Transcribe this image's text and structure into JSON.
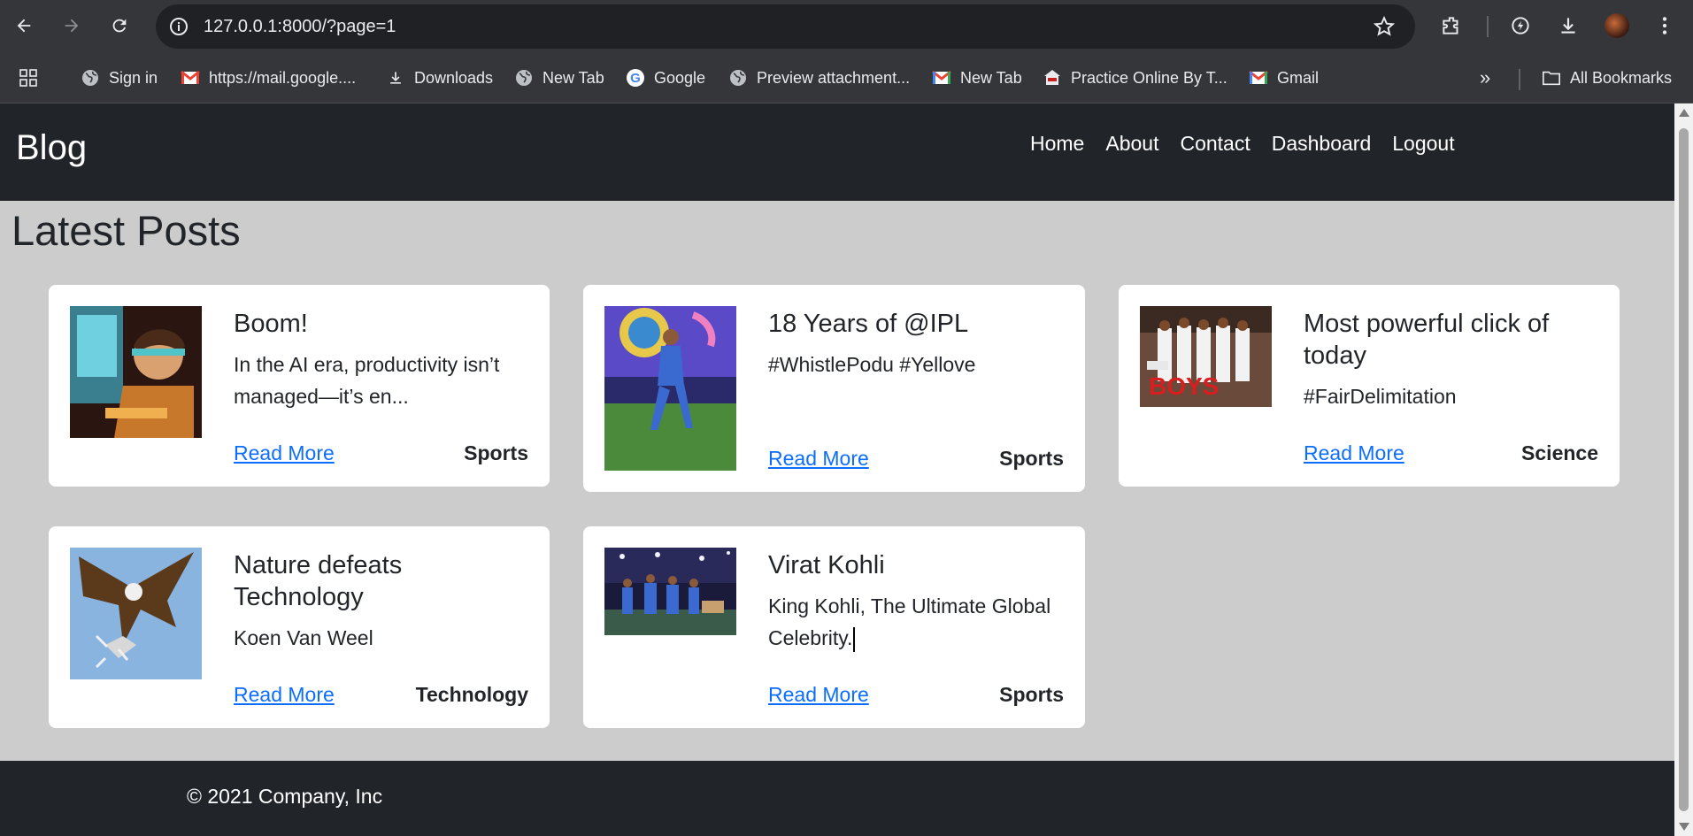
{
  "browser": {
    "url": "127.0.0.1:8000/?page=1",
    "bookmarks": [
      {
        "label": "Sign in",
        "icon": "globe-icon"
      },
      {
        "label": "https://mail.google....",
        "icon": "gmail-icon"
      },
      {
        "label": "Downloads",
        "icon": "download-icon"
      },
      {
        "label": "New Tab",
        "icon": "globe-icon"
      },
      {
        "label": "Google",
        "icon": "google-icon"
      },
      {
        "label": "Preview attachment...",
        "icon": "globe-icon"
      },
      {
        "label": "New Tab",
        "icon": "gmail-icon"
      },
      {
        "label": "Practice Online By T...",
        "icon": "site-icon"
      },
      {
        "label": "Gmail",
        "icon": "gmail-icon"
      }
    ],
    "all_bookmarks": "All Bookmarks"
  },
  "navbar": {
    "brand": "Blog",
    "links": [
      "Home",
      "About",
      "Contact",
      "Dashboard",
      "Logout"
    ]
  },
  "main": {
    "heading": "Latest Posts",
    "posts": [
      {
        "title": "Boom!",
        "excerpt": "In the AI era, productivity isn’t managed—it’s en...",
        "read_more": "Read More",
        "category": "Sports",
        "image": "boy-at-computer"
      },
      {
        "title": "18 Years of @IPL",
        "excerpt": "#WhistlePodu #Yellove",
        "read_more": "Read More",
        "category": "Sports",
        "image": "cricketer-walking"
      },
      {
        "title": "Most powerful click of today",
        "excerpt": "#FairDelimitation",
        "read_more": "Read More",
        "category": "Science",
        "image": "the-boys-group"
      },
      {
        "title": "Nature defeats Technology",
        "excerpt": "Koen Van Weel",
        "read_more": "Read More",
        "category": "Technology",
        "image": "eagle-drone"
      },
      {
        "title": "Virat Kohli",
        "excerpt": "King Kohli, The Ultimate Global Celebrity.",
        "read_more": "Read More",
        "category": "Sports",
        "image": "stadium-celebration"
      }
    ]
  },
  "footer": {
    "copyright": "© 2021 Company, Inc"
  },
  "colors": {
    "navbar_bg": "#212529",
    "page_bg": "#cccccc",
    "link": "#0d6efd"
  }
}
